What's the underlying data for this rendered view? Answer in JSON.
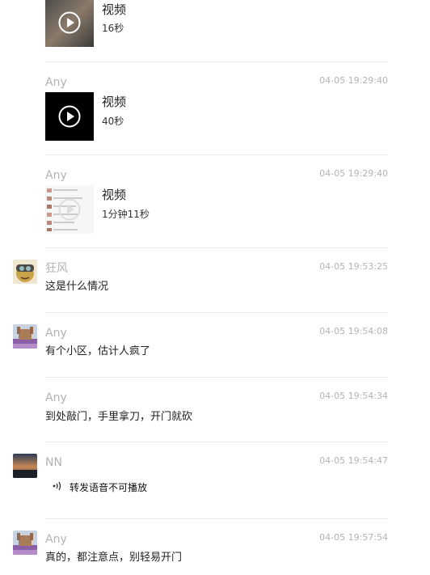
{
  "messages": [
    {
      "video_title": "视频",
      "video_duration": "16秒"
    },
    {
      "sender": "Any",
      "time": "04-05 19:29:40",
      "video_title": "视频",
      "video_duration": "40秒"
    },
    {
      "sender": "Any",
      "time": "04-05 19:29:40",
      "video_title": "视频",
      "video_duration": "1分钟11秒"
    },
    {
      "sender": "狂风",
      "time": "04-05 19:53:25",
      "text": "这是什么情况"
    },
    {
      "sender": "Any",
      "time": "04-05 19:54:08",
      "text": "有个小区，估计人疯了"
    },
    {
      "sender": "Any",
      "time": "04-05 19:54:34",
      "text": "到处敲门，手里拿刀，开门就砍"
    },
    {
      "sender": "NN",
      "time": "04-05 19:54:47",
      "voice_text": "转发语音不可播放"
    },
    {
      "sender": "Any",
      "time": "04-05 19:57:54",
      "text": "真的，都注意点，别轻易开门"
    }
  ],
  "colors": {
    "meta": "#b3b3b3",
    "separator": "#e9e9e9",
    "text": "#222222"
  }
}
